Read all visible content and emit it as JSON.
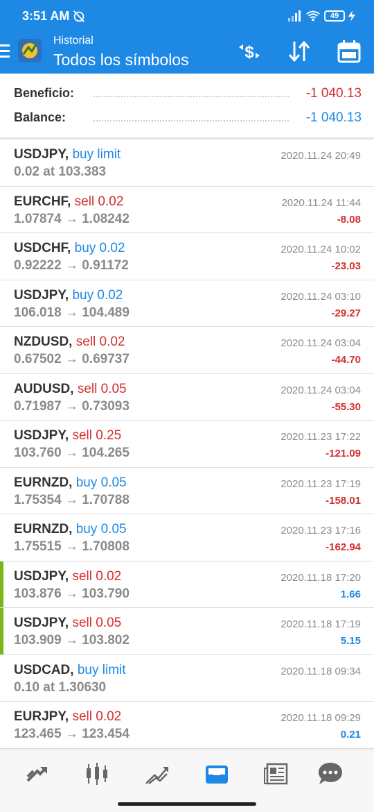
{
  "status_bar": {
    "time": "3:51 AM",
    "battery": "49"
  },
  "header": {
    "subtitle": "Historial",
    "title": "Todos los símbolos"
  },
  "summary": {
    "profit_label": "Beneficio:",
    "profit_value": "-1 040.13",
    "balance_label": "Balance:",
    "balance_value": "-1 040.13"
  },
  "trades": [
    {
      "symbol": "USDJPY,",
      "type": "buy limit",
      "prices": "0.02 at 103.383",
      "date": "2020.11.24 20:49",
      "profit": ""
    },
    {
      "symbol": "EURCHF,",
      "type": "sell 0.02",
      "prices": "1.07874 → 1.08242",
      "date": "2020.11.24 11:44",
      "profit": "-8.08"
    },
    {
      "symbol": "USDCHF,",
      "type": "buy 0.02",
      "prices": "0.92222 → 0.91172",
      "date": "2020.11.24 10:02",
      "profit": "-23.03"
    },
    {
      "symbol": "USDJPY,",
      "type": "buy 0.02",
      "prices": "106.018 → 104.489",
      "date": "2020.11.24 03:10",
      "profit": "-29.27"
    },
    {
      "symbol": "NZDUSD,",
      "type": "sell 0.02",
      "prices": "0.67502 → 0.69737",
      "date": "2020.11.24 03:04",
      "profit": "-44.70"
    },
    {
      "symbol": "AUDUSD,",
      "type": "sell 0.05",
      "prices": "0.71987 → 0.73093",
      "date": "2020.11.24 03:04",
      "profit": "-55.30"
    },
    {
      "symbol": "USDJPY,",
      "type": "sell 0.25",
      "prices": "103.760 → 104.265",
      "date": "2020.11.23 17:22",
      "profit": "-121.09"
    },
    {
      "symbol": "EURNZD,",
      "type": "buy 0.05",
      "prices": "1.75354 → 1.70788",
      "date": "2020.11.23 17:19",
      "profit": "-158.01"
    },
    {
      "symbol": "EURNZD,",
      "type": "buy 0.05",
      "prices": "1.75515 → 1.70808",
      "date": "2020.11.23 17:16",
      "profit": "-162.94"
    },
    {
      "symbol": "USDJPY,",
      "type": "sell 0.02",
      "prices": "103.876 → 103.790",
      "date": "2020.11.18 17:20",
      "profit": "1.66"
    },
    {
      "symbol": "USDJPY,",
      "type": "sell 0.05",
      "prices": "103.909 → 103.802",
      "date": "2020.11.18 17:19",
      "profit": "5.15"
    },
    {
      "symbol": "USDCAD,",
      "type": "buy limit",
      "prices": "0.10 at 1.30630",
      "date": "2020.11.18 09:34",
      "profit": ""
    },
    {
      "symbol": "EURJPY,",
      "type": "sell 0.02",
      "prices": "123.465 → 123.454",
      "date": "2020.11.18 09:29",
      "profit": "0.21"
    }
  ],
  "icons": {
    "actions": [
      "currency-exchange-icon",
      "sort-icon",
      "calendar-icon"
    ],
    "nav": [
      "quotes-icon",
      "chart-icon",
      "trade-icon",
      "history-icon",
      "news-icon",
      "chat-icon"
    ]
  },
  "colors": {
    "primary": "#1e88e5",
    "negative": "#d32f2f",
    "positive": "#1e88e5",
    "flag": "#7cb518"
  }
}
